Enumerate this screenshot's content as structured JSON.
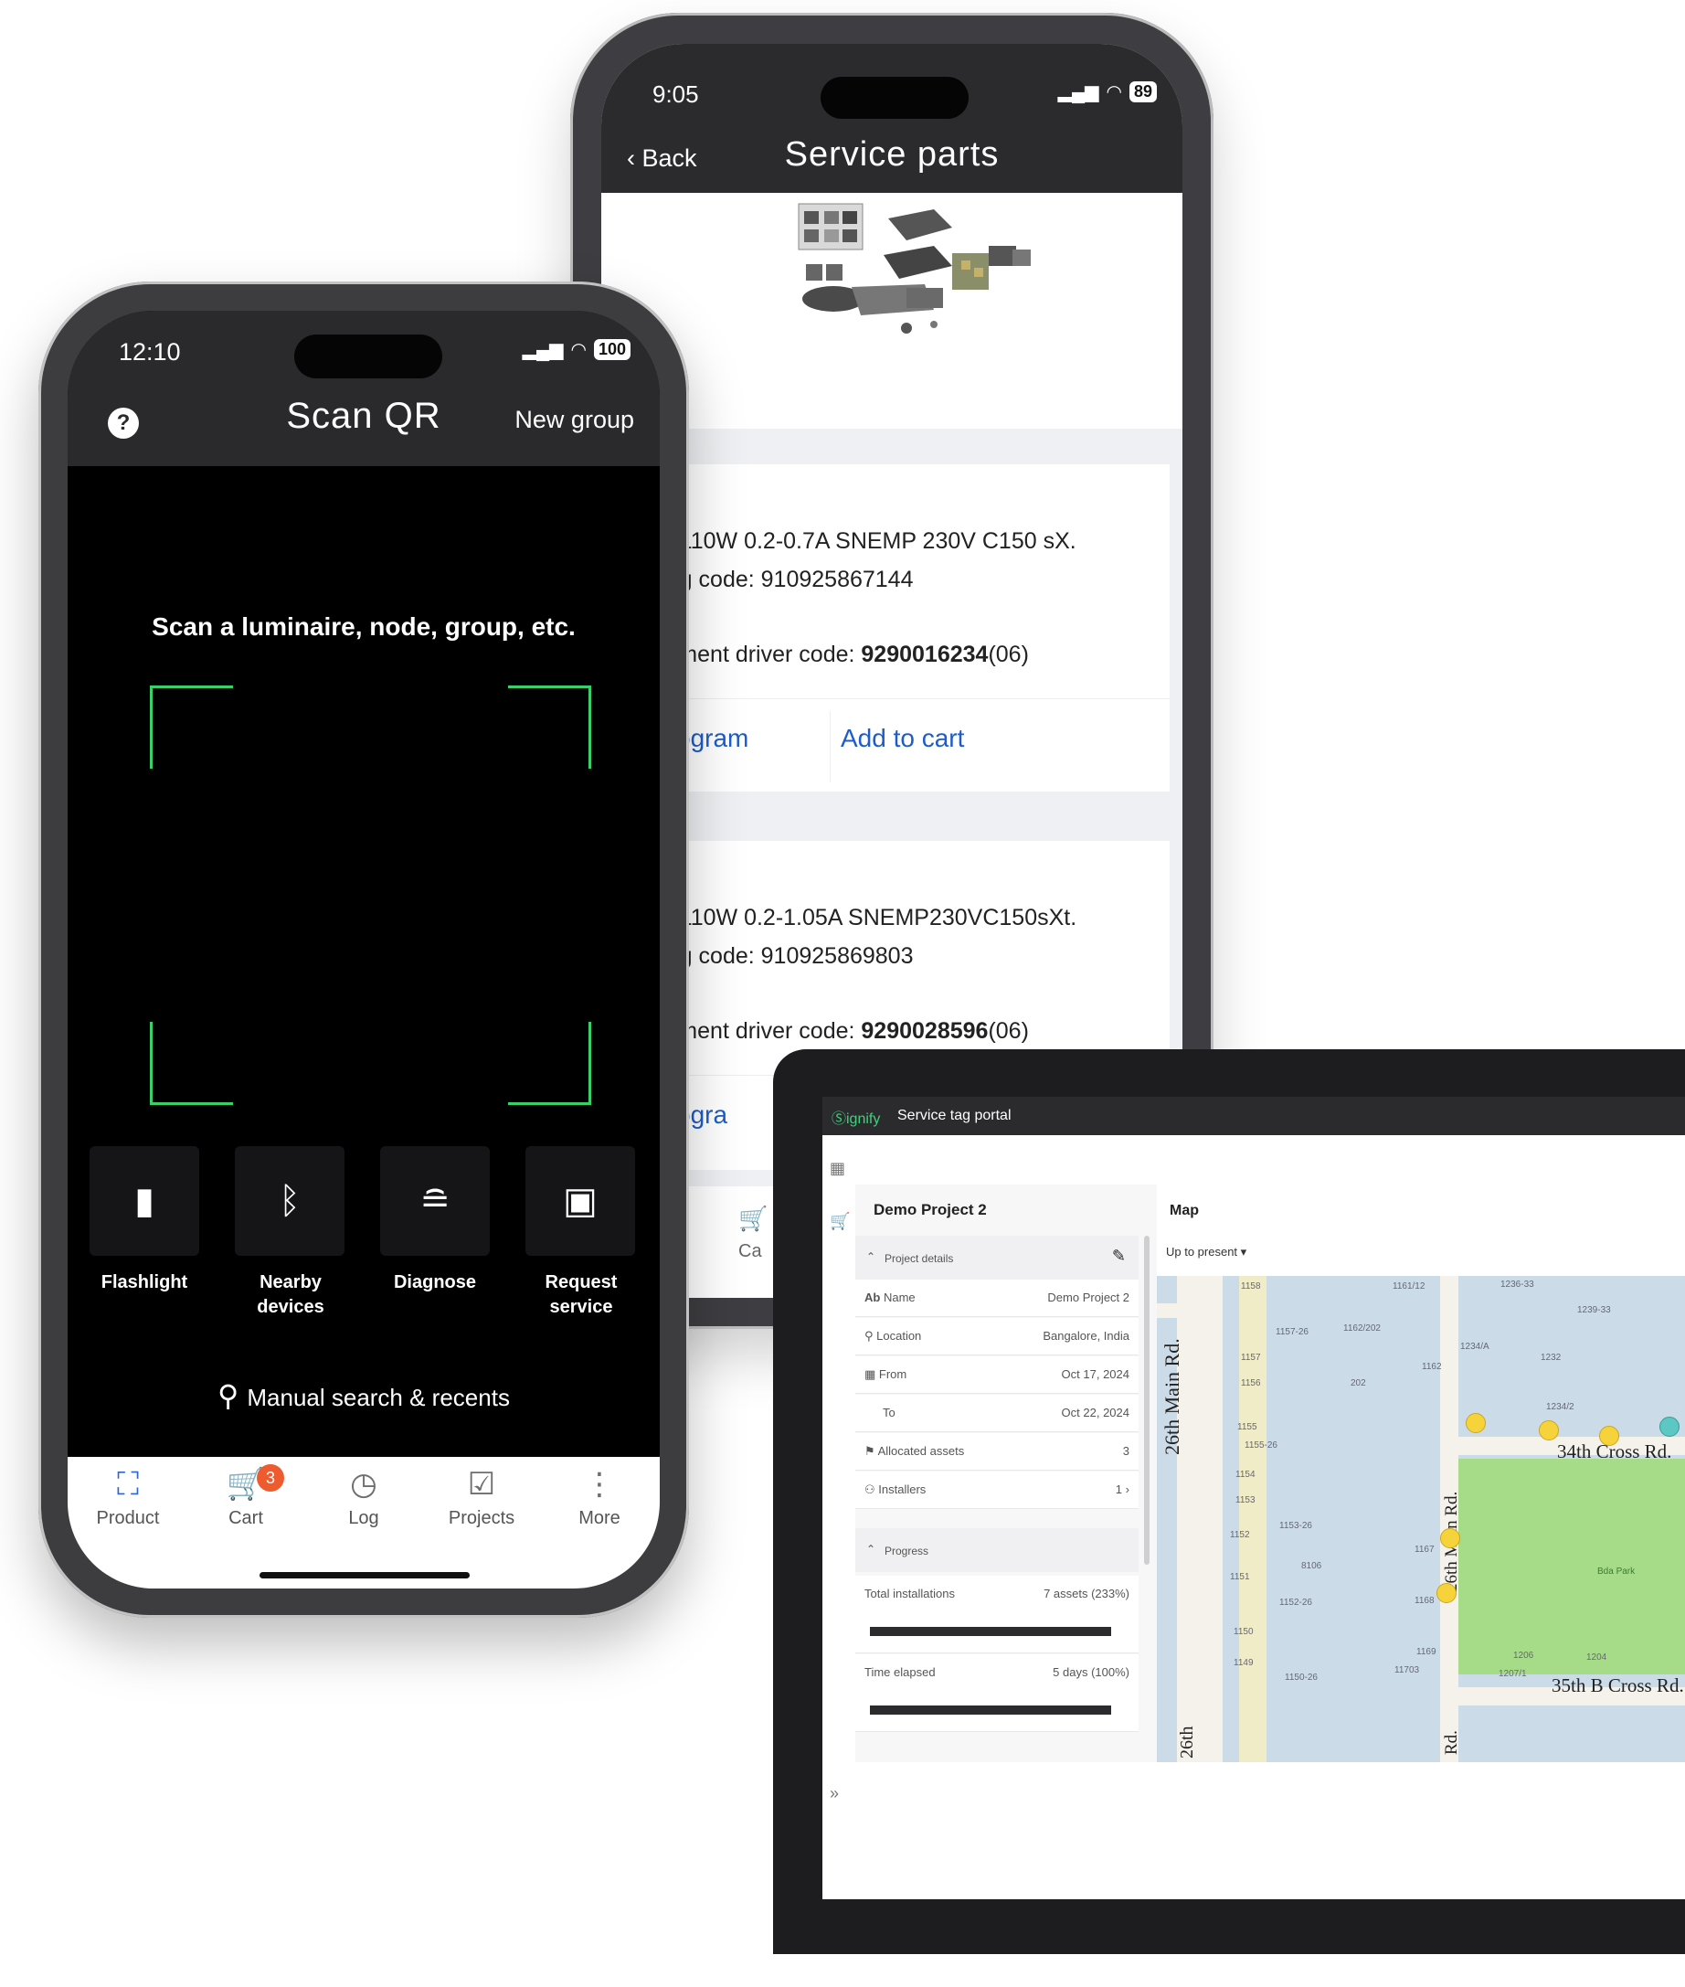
{
  "service_phone": {
    "status": {
      "time": "9:05",
      "battery": "89"
    },
    "header": {
      "back_label": "Back",
      "title": "Service parts"
    },
    "items": [
      {
        "title_fragment": "er",
        "product": "SR 110W 0.2-0.7A SNEMP 230V C150 sX.",
        "ordering_code": "ering code: 910925867144",
        "replacement_label": "acement driver code: ",
        "replacement_code": "9290016234",
        "replacement_suffix": "(06)",
        "program_label": "Program",
        "cart_label": "Add to cart"
      },
      {
        "title_fragment": "er",
        "product": "SR 110W 0.2-1.05A SNEMP230VC150sXt.",
        "ordering_code": "ering code: 910925869803",
        "replacement_label": "acement driver code: ",
        "replacement_code": "9290028596",
        "replacement_suffix": "(06)",
        "program_label": "Progra"
      }
    ],
    "tab_fragment": "Ca"
  },
  "scan_phone": {
    "status": {
      "time": "12:10",
      "battery": "100"
    },
    "header": {
      "help": "?",
      "title": "Scan QR",
      "new_group": "New group"
    },
    "scan_message": "Scan a luminaire, node, group, etc.",
    "tools": [
      {
        "icon": "flashlight-icon",
        "label": "Flashlight"
      },
      {
        "icon": "bluetooth-icon",
        "label": "Nearby devices"
      },
      {
        "icon": "diagnose-icon",
        "label": "Diagnose"
      },
      {
        "icon": "request-service-icon",
        "label": "Request service"
      }
    ],
    "manual_search": "Manual search & recents",
    "tabs": [
      {
        "icon": "product-icon",
        "label": "Product"
      },
      {
        "icon": "cart-icon",
        "label": "Cart",
        "badge": "3"
      },
      {
        "icon": "log-icon",
        "label": "Log"
      },
      {
        "icon": "projects-icon",
        "label": "Projects"
      },
      {
        "icon": "more-icon",
        "label": "More"
      }
    ],
    "colors": {
      "scan_frame": "#39d06c",
      "cart_badge": "#ee5b2f"
    }
  },
  "portal": {
    "brand": "Ⓢignify",
    "app_name": "Service tag portal",
    "project_title": "Demo Project 2",
    "project_details_label": "Project details",
    "details": [
      {
        "label": "Name",
        "value": "Demo Project 2"
      },
      {
        "label": "Location",
        "value": "Bangalore, India"
      },
      {
        "label": "From",
        "value": "Oct 17, 2024"
      },
      {
        "label": "To",
        "value": "Oct 22, 2024"
      },
      {
        "label": "Allocated assets",
        "value": "3"
      },
      {
        "label": "Installers",
        "value": "1"
      }
    ],
    "progress_label": "Progress",
    "progress": [
      {
        "label": "Total installations",
        "value": "7 assets (233%)"
      },
      {
        "label": "Time elapsed",
        "value": "5 days (100%)"
      }
    ],
    "map": {
      "title": "Map",
      "filter": "Up to present",
      "streets": [
        "26th Main Rd.",
        "34th Cross Rd.",
        "26th Main Rd.",
        "35th B Cross Rd.",
        "26th",
        "Rd."
      ],
      "park": "Bda Park",
      "plots": [
        "1158",
        "1161/12",
        "1236-33",
        "1239-33",
        "1157-26",
        "1162/202",
        "1234/A",
        "1232",
        "1157",
        "1156",
        "202",
        "1162",
        "1155",
        "1234/2",
        "1155-26",
        "1154",
        "1153",
        "1153-26",
        "1152",
        "1167",
        "1151",
        "8106",
        "1168",
        "1152-26",
        "1150",
        "1169",
        "1206",
        "1204",
        "1149",
        "1150-26",
        "11703",
        "1207/1"
      ]
    }
  }
}
